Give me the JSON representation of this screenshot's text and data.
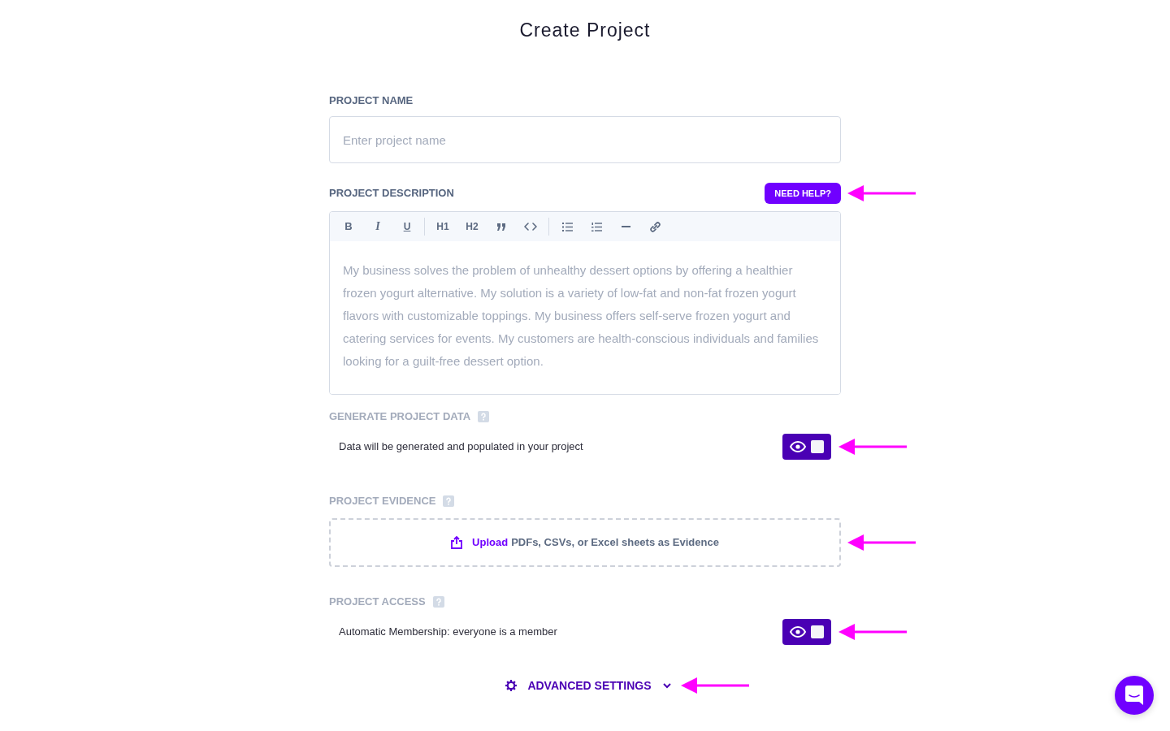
{
  "title": "Create Project",
  "sections": [
    {
      "kind": "text-input",
      "label": "PROJECT NAME",
      "placeholder": "Enter project name"
    },
    {
      "kind": "editor",
      "label": "PROJECT DESCRIPTION",
      "help_button": {
        "label": "NEED HELP?",
        "annotated": true
      },
      "toolbar": [
        [
          {
            "kind": "bold",
            "label": "B"
          },
          {
            "kind": "italic",
            "label": "I"
          },
          {
            "kind": "underline",
            "label": "U"
          }
        ],
        [
          {
            "kind": "heading",
            "label": "H1"
          },
          {
            "kind": "heading",
            "label": "H2"
          },
          {
            "kind": "quote"
          },
          {
            "kind": "code"
          }
        ],
        [
          {
            "kind": "bullet-list"
          },
          {
            "kind": "numbered-list"
          },
          {
            "kind": "rule"
          },
          {
            "kind": "link"
          }
        ]
      ],
      "placeholder": "My business solves the problem of unhealthy dessert options by offering a healthier frozen yogurt alternative. My solution is a variety of low-fat and non-fat frozen yogurt flavors with customizable toppings. My business offers self-serve frozen yogurt and catering services for events. My customers are health-conscious individuals and families looking for a guilt-free dessert option."
    },
    {
      "kind": "toggle",
      "label": "GENERATE PROJECT DATA",
      "help_icon": true,
      "description": "Data will be generated and populated in your project",
      "on": true,
      "annotated": true
    },
    {
      "kind": "upload",
      "label": "PROJECT EVIDENCE",
      "help_icon": true,
      "link": "Upload",
      "text": "PDFs, CSVs, or Excel sheets as Evidence",
      "annotated": true
    },
    {
      "kind": "toggle",
      "label": "PROJECT ACCESS",
      "help_icon": true,
      "description": "Automatic Membership: everyone is a member",
      "on": true,
      "annotated": true
    }
  ],
  "advanced_settings": {
    "label": "ADVANCED SETTINGS",
    "expanded": false,
    "annotated": true
  }
}
